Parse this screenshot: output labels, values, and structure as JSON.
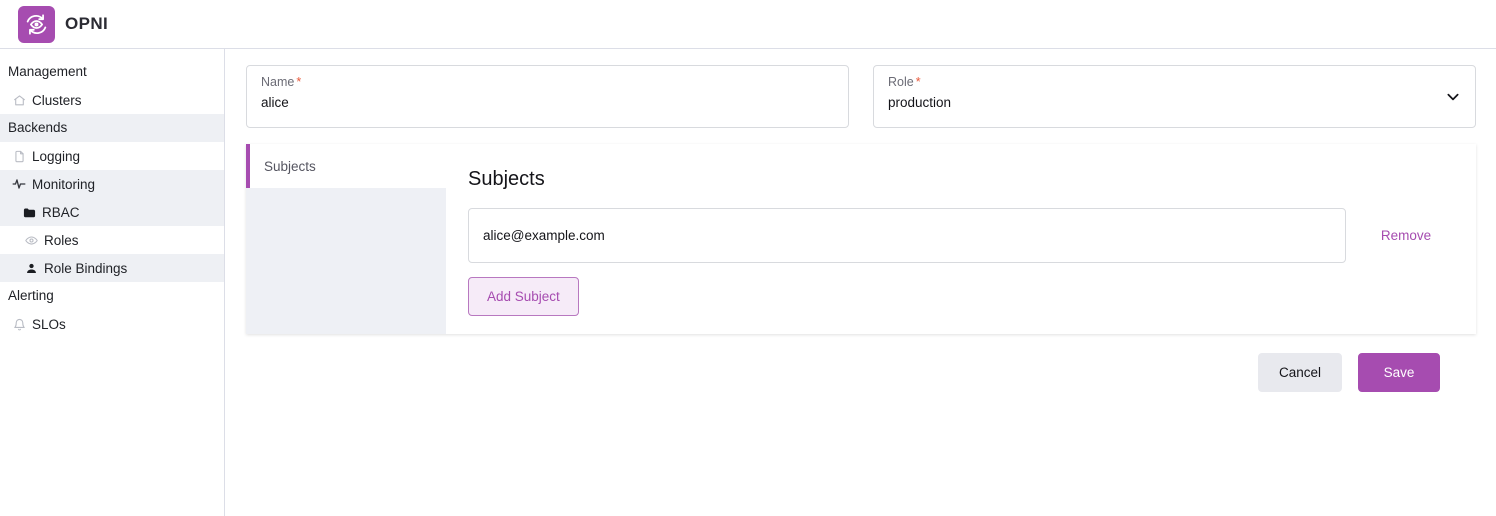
{
  "header": {
    "brand_name": "OPNI",
    "logo_icon": "opni-eye-refresh-icon",
    "brand_color": "#a64cb0"
  },
  "sidebar": {
    "groups": [
      {
        "label": "Management",
        "shaded": false,
        "items": [
          {
            "label": "Clusters",
            "icon": "home-icon",
            "level": 1,
            "shaded": false
          }
        ]
      },
      {
        "label": "Backends",
        "shaded": true,
        "items": [
          {
            "label": "Logging",
            "icon": "file-icon",
            "level": 1,
            "shaded": false
          },
          {
            "label": "Monitoring",
            "icon": "activity-icon",
            "level": 1,
            "shaded": true
          },
          {
            "label": "RBAC",
            "icon": "folder-icon",
            "level": 1,
            "shaded": true
          },
          {
            "label": "Roles",
            "icon": "eye-icon",
            "level": 2,
            "shaded": false
          },
          {
            "label": "Role Bindings",
            "icon": "user-icon",
            "level": 2,
            "shaded": true
          }
        ]
      },
      {
        "label": "Alerting",
        "shaded": false,
        "items": [
          {
            "label": "SLOs",
            "icon": "bell-icon",
            "level": 1,
            "shaded": false
          }
        ]
      }
    ]
  },
  "form": {
    "name_field": {
      "label": "Name",
      "required_marker": "*",
      "value": "alice",
      "placeholder": "Name"
    },
    "role_field": {
      "label": "Role",
      "required_marker": "*",
      "value": "production",
      "placeholder": "Role",
      "dropdown_icon": "chevron-down-icon"
    }
  },
  "card": {
    "tabs": [
      {
        "label": "Subjects",
        "active": true
      }
    ],
    "panel": {
      "title": "Subjects",
      "subjects": [
        {
          "value": "alice@example.com",
          "placeholder": "Subject",
          "remove_label": "Remove"
        }
      ],
      "add_label": "Add Subject"
    }
  },
  "footer": {
    "cancel_label": "Cancel",
    "save_label": "Save"
  }
}
